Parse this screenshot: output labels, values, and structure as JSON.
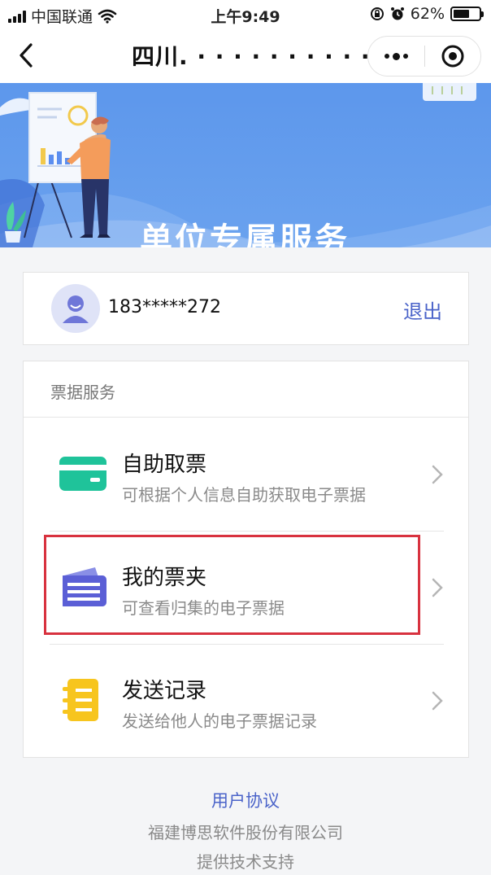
{
  "status_bar": {
    "carrier": "中国联通",
    "time": "上午9:49",
    "battery_percent": "62%",
    "battery_level": 0.62
  },
  "nav": {
    "title": "四川.  · · · · · · · · · · · ·..."
  },
  "banner": {
    "title": "单位专属服务"
  },
  "user": {
    "phone": "183*****272",
    "logout_label": "退出"
  },
  "services": {
    "section_title": "票据服务",
    "items": [
      {
        "title": "自助取票",
        "desc": "可根据个人信息自助获取电子票据",
        "icon": "card-icon",
        "color": "#1fc39a"
      },
      {
        "title": "我的票夹",
        "desc": "可查看归集的电子票据",
        "icon": "ticket-folder-icon",
        "color": "#5b5fd6"
      },
      {
        "title": "发送记录",
        "desc": "发送给他人的电子票据记录",
        "icon": "record-list-icon",
        "color": "#f7c51e"
      }
    ]
  },
  "footer": {
    "agreement_label": "用户协议",
    "company": "福建博思软件股份有限公司",
    "support": "提供技术支持"
  },
  "colors": {
    "accent": "#4a63c9",
    "banner": "#6aa2ee",
    "highlight": "#d8323f"
  }
}
